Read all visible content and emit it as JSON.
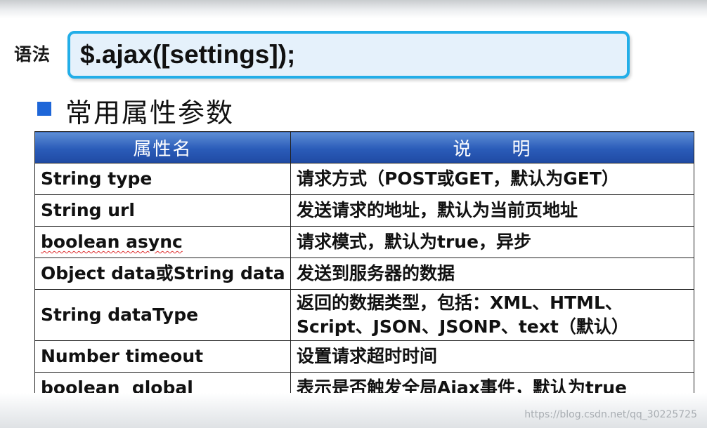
{
  "syntax": {
    "label": "语法",
    "code": "$.ajax([settings]);"
  },
  "section": {
    "title": "常用属性参数",
    "bullet_color": "#1e66d8"
  },
  "table": {
    "header": {
      "name": "属性名",
      "description": "说　　明"
    },
    "header_color": "#2a5bb8",
    "rows": [
      {
        "name": "String type",
        "description": "请求方式（POST或GET，默认为GET）"
      },
      {
        "name": "String url",
        "description": "发送请求的地址，默认为当前页地址"
      },
      {
        "name": "boolean async",
        "description": "请求模式，默认为true，异步"
      },
      {
        "name": "Object data或String data",
        "description": "发送到服务器的数据"
      },
      {
        "name": "String dataType",
        "description": "返回的数据类型，包括：XML、HTML、Script、JSON、JSONP、text（默认）"
      },
      {
        "name": "Number timeout",
        "description": "设置请求超时时间"
      },
      {
        "name": "boolean  global",
        "description": "表示是否触发全局Ajax事件，默认为true"
      }
    ]
  },
  "watermark": "https://blog.csdn.net/qq_30225725",
  "colors": {
    "syntax_border": "#22aee8",
    "syntax_fill": "#e5f1fb"
  }
}
